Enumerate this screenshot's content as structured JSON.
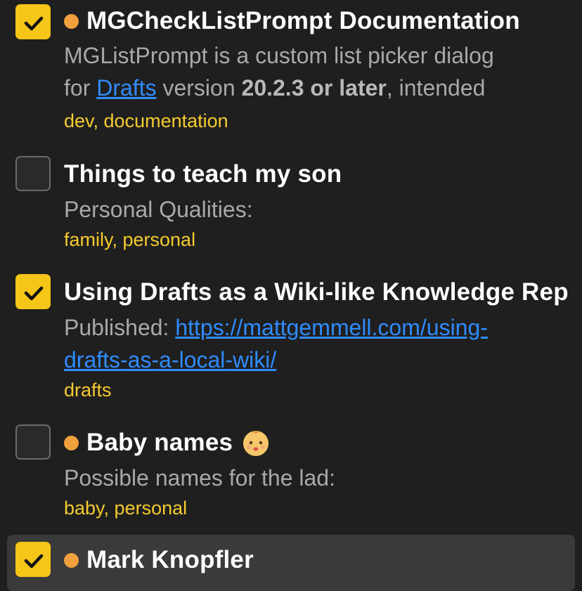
{
  "items": [
    {
      "title": "MGCheckListPrompt Documentation",
      "checked": true,
      "flagged": true,
      "body_prefix": "MGListPrompt is a custom list picker dialog",
      "body_l2_a": "for ",
      "body_l2_link": "Drafts",
      "body_l2_b": " version ",
      "body_l2_bold": "20.2.3 or later",
      "body_l2_c": ", intended",
      "tags": "dev, documentation"
    },
    {
      "title": "Things to teach my son",
      "checked": false,
      "flagged": false,
      "body": "Personal Qualities:",
      "tags": "family, personal"
    },
    {
      "title": "Using Drafts as a Wiki-like Knowledge Rep",
      "checked": true,
      "flagged": false,
      "body_label": "Published: ",
      "body_link_l1": "https://mattgemmell.com/using-",
      "body_link_l2": "drafts-as-a-local-wiki/",
      "tags": "drafts"
    },
    {
      "title": "Baby names",
      "emoji": "baby-face",
      "checked": false,
      "flagged": true,
      "body": "Possible names for the lad:",
      "tags": "baby, personal"
    },
    {
      "title": "Mark Knopfler",
      "checked": true,
      "flagged": true
    }
  ],
  "colors": {
    "background": "#1f1f1f",
    "checkbox_checked": "#f5c518",
    "flag_dot": "#f0a03c",
    "tags": "#f5cb2e",
    "link": "#2f8cff",
    "selected_row": "#3a3a3a"
  }
}
